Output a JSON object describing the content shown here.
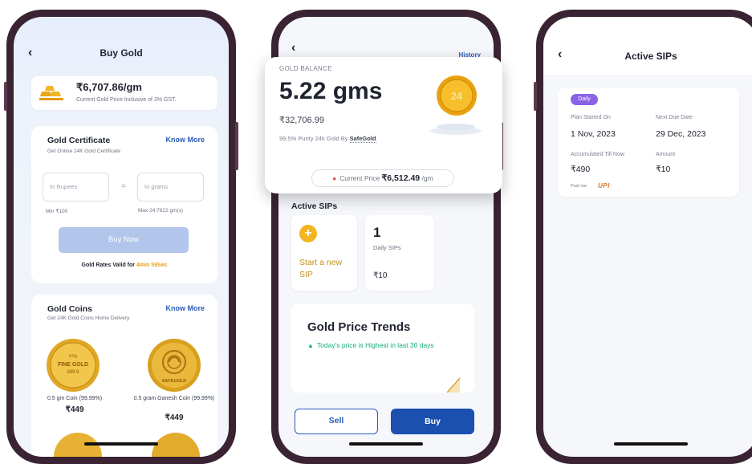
{
  "phone1": {
    "title": "Buy Gold",
    "price": "₹6,707.86/gm",
    "price_note": "Current Gold Price Inclusive of 3% GST.",
    "certificate": {
      "title": "Gold Certificate",
      "subtitle": "Get Online 24K Gold Certificate",
      "link": "Know More",
      "rupees_placeholder": "In Rupees",
      "equals": "=",
      "grams_placeholder": "In grams",
      "min": "Min ₹100",
      "max": "Max 24.7822 gm(s)",
      "buy_now": "Buy Now",
      "rates_prefix": "Gold Rates Valid for",
      "rates_timer": "4min 59Sec"
    },
    "coins": {
      "title": "Gold Coins",
      "subtitle": "Get 24K Gold Coins Home Delivery",
      "link": "Know More",
      "items": [
        {
          "name": "0.5 gm Coin (99.99%)",
          "price": "₹449",
          "engraving_top": "0.5g",
          "engraving_main": "FINE GOLD",
          "engraving_sub": "999.9"
        },
        {
          "name": "0.5 gram Ganesh Coin (99.99%)",
          "price": "₹449",
          "engraving_main": "SAFEGOLD"
        }
      ]
    }
  },
  "phone2": {
    "history_link": "History",
    "balance": {
      "label": "GOLD BALANCE",
      "grams": "5.22 gms",
      "rupees": "₹32,706.99",
      "purity_prefix": "99.5% Purity 24k Gold By",
      "brand": "SafeGold",
      "coin_mark": "24",
      "current_price_label": "Current Price",
      "current_price_value": "₹6,512.49",
      "current_price_unit": "/gm"
    },
    "active_sips_title": "Active SIPs",
    "start_sip": "Start a new SIP",
    "sip_count": "1",
    "sip_kind": "Daily SIPs",
    "sip_amount": "₹10",
    "trends": {
      "title": "Gold Price Trends",
      "subtitle": "Today's price is Highest in last 30 days"
    },
    "sell_label": "Sell",
    "buy_label": "Buy"
  },
  "phone3": {
    "title": "Active SIPs",
    "badge": "Daily",
    "plan_started_label": "Plan Started On",
    "plan_started_value": "1 Nov, 2023",
    "next_due_label": "Next Due Date",
    "next_due_value": "29 Dec, 2023",
    "accumulated_label": "Accumulated Till Now",
    "accumulated_value": "₹490",
    "amount_label": "Amount",
    "amount_value": "₹10",
    "paid_via": "Paid via:",
    "payment_method": "UPI"
  },
  "colors": {
    "accent_blue": "#2b5bb8",
    "primary_button": "#1b4fb0",
    "gold": "#f4b523",
    "timer_orange": "#e3a118",
    "trend_green": "#16a974",
    "badge_purple": "#8a63e4"
  }
}
